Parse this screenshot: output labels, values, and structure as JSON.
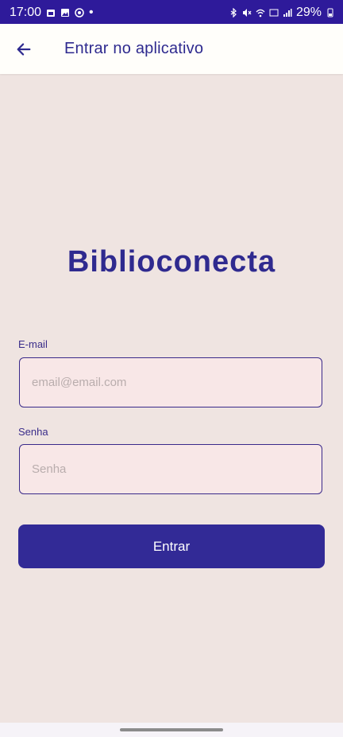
{
  "status_bar": {
    "time": "17:00",
    "dot": "•",
    "battery": "29%"
  },
  "app_bar": {
    "title": "Entrar no aplicativo"
  },
  "brand": {
    "name": "Biblioconecta"
  },
  "form": {
    "email": {
      "label": "E-mail",
      "value": "",
      "placeholder": "email@email.com"
    },
    "password": {
      "label": "Senha",
      "value": "",
      "placeholder": "Senha"
    },
    "submit_label": "Entrar"
  },
  "colors": {
    "status_bar": "#2e1a9a",
    "app_bar": "#fffefa",
    "page_background": "#efe4e1",
    "accent": "#322a96",
    "input_background": "#f8e7e7"
  },
  "icons": {
    "back": "arrow-left-icon",
    "status": [
      "calendar-icon",
      "gallery-icon",
      "whatsapp-icon",
      "bluetooth-icon",
      "mute-icon",
      "wifi-icon",
      "volte-icon",
      "signal-icon",
      "battery-icon"
    ]
  }
}
